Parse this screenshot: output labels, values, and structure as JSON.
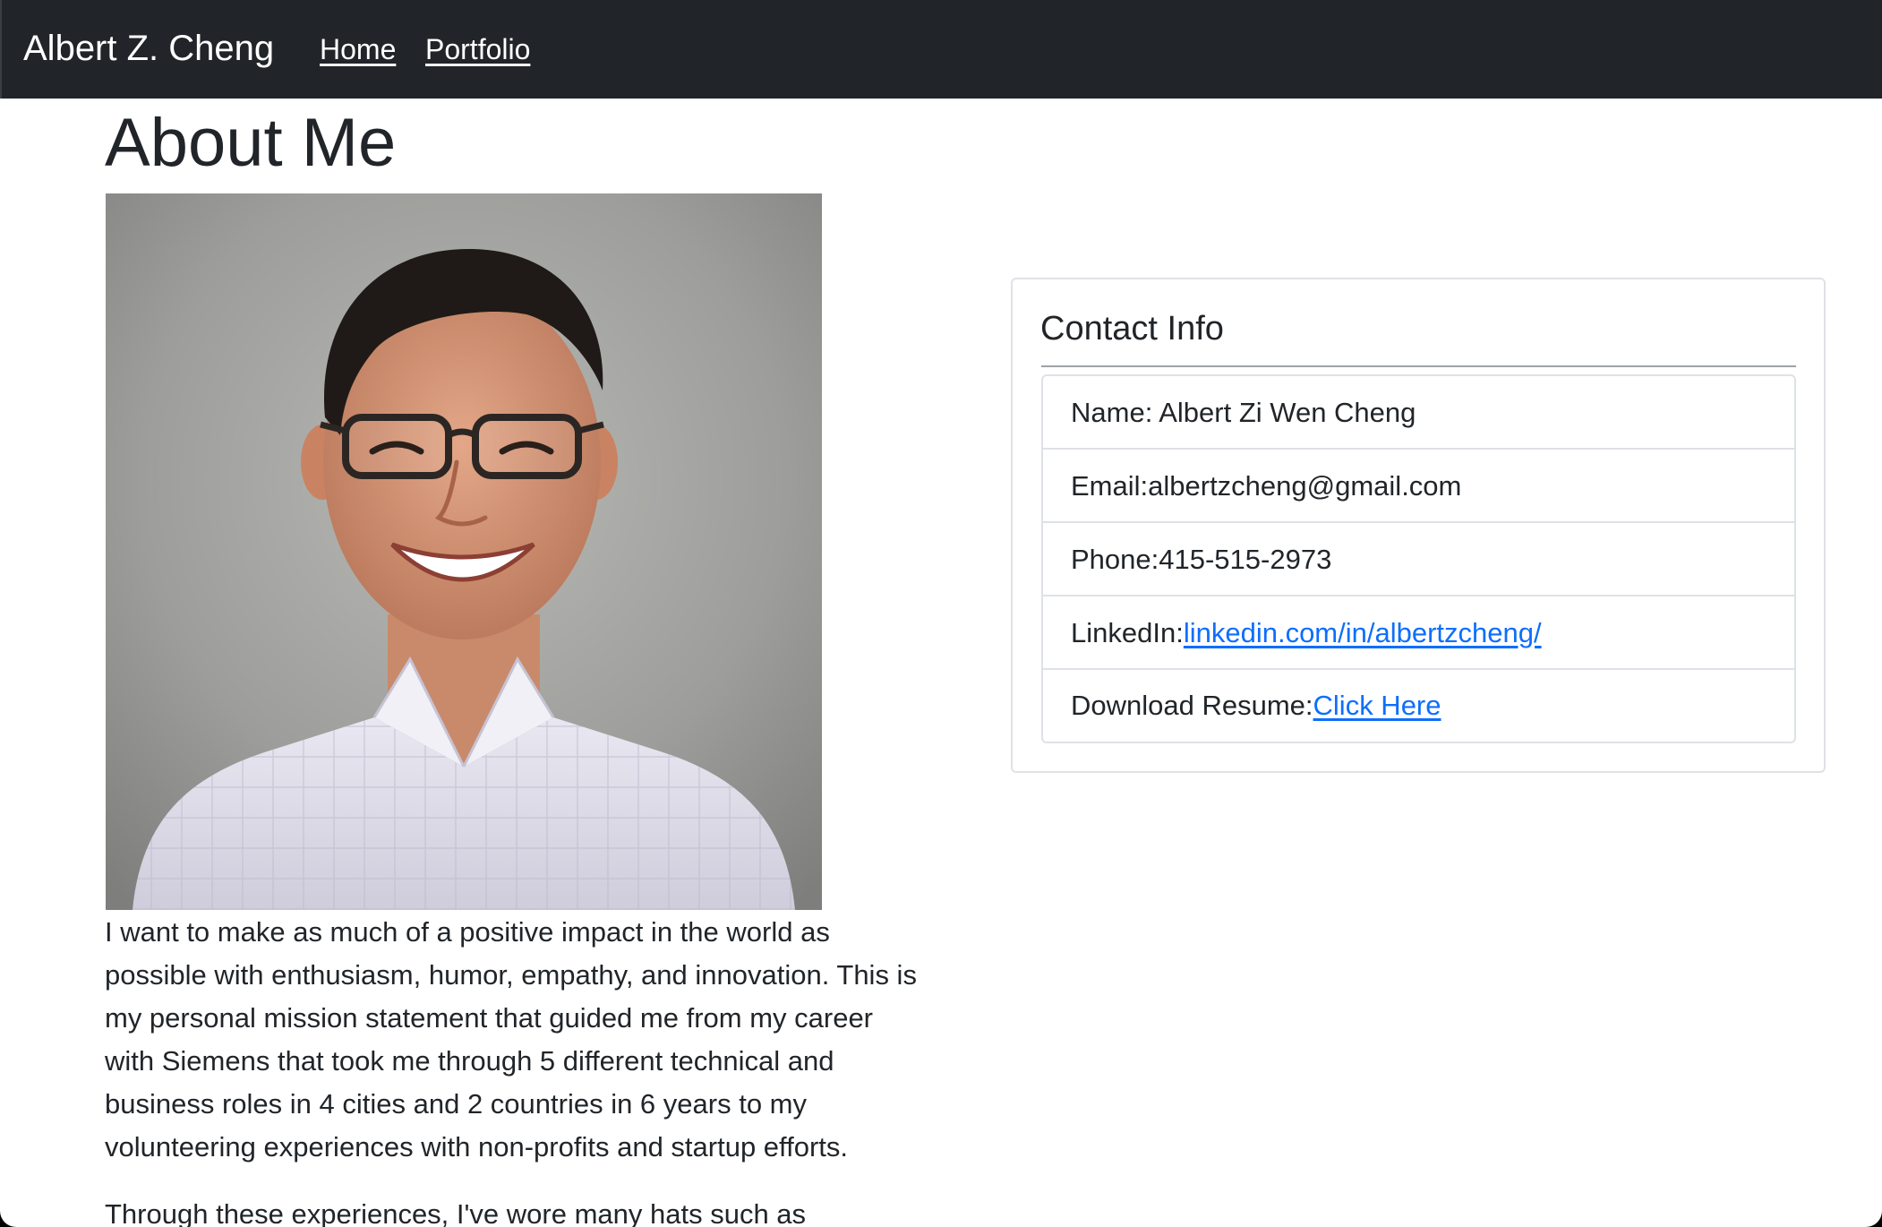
{
  "navbar": {
    "brand": "Albert Z. Cheng",
    "links": [
      {
        "label": "Home"
      },
      {
        "label": "Portfolio"
      }
    ]
  },
  "main": {
    "title": "About Me",
    "photo_alt": "Portrait of Albert Z. Cheng",
    "bio": [
      "I want to make as much of a positive impact in the world as possible with enthusiasm, humor, empathy, and innovation. This is my personal mission statement that guided me from my career with Siemens that took me through 5 different technical and business roles in 4 cities and 2 countries in 6 years to my volunteering experiences with non-profits and startup efforts.",
      "Through these experiences, I've wore many hats such as"
    ]
  },
  "contact": {
    "title": "Contact Info",
    "name": {
      "label": "Name: ",
      "value": "Albert Zi Wen Cheng"
    },
    "email": {
      "label": "Email:",
      "value": "albertzcheng@gmail.com"
    },
    "phone": {
      "label": "Phone:",
      "value": "415-515-2973"
    },
    "linkedin": {
      "label": "LinkedIn:",
      "link": "linkedin.com/in/albertzcheng/"
    },
    "resume": {
      "label": "Download Resume:",
      "link": "Click Here"
    }
  },
  "colors": {
    "navbar_bg": "#212529",
    "link": "#0d6efd",
    "text": "#212529"
  }
}
